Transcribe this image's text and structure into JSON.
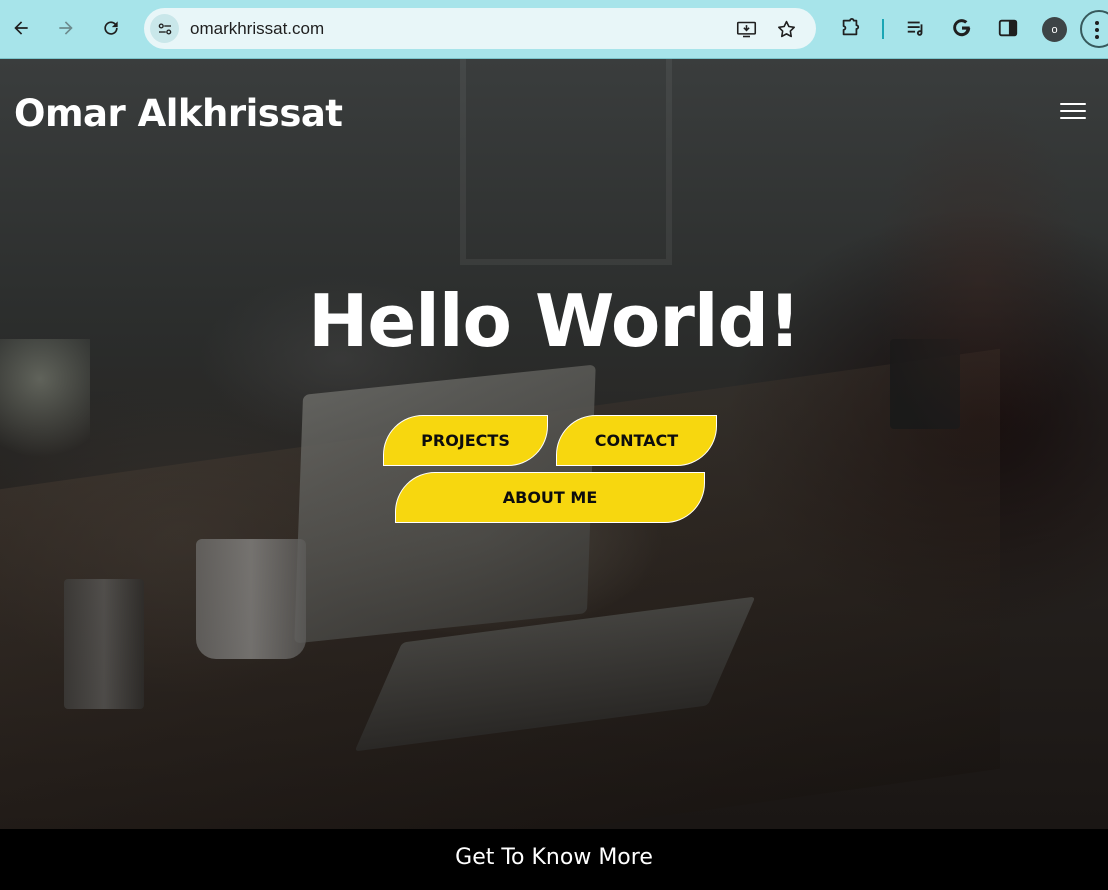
{
  "browser": {
    "url": "omarkhrissat.com",
    "profile_initial": "o",
    "icons": {
      "back": "back-arrow-icon",
      "forward": "forward-arrow-icon",
      "reload": "reload-icon",
      "site_info": "site-info-icon",
      "install": "install-app-icon",
      "bookmark": "star-icon",
      "extensions": "puzzle-icon",
      "media": "media-queue-icon",
      "google": "google-icon",
      "side_panel": "side-panel-icon",
      "menu": "kebab-menu-icon"
    },
    "colors": {
      "toolbar": "#a7e4ea",
      "omnibox": "#e8f6f8"
    }
  },
  "site": {
    "brand": "Omar Alkhrissat",
    "nav_icon": "hamburger-menu-icon",
    "headline": "Hello World!",
    "buttons": {
      "projects": "PROJECTS",
      "contact": "CONTACT",
      "about": "ABOUT ME"
    },
    "footer_link": "Get To Know More",
    "colors": {
      "accent": "#f7d70f",
      "text": "#ffffff",
      "background": "#000000"
    }
  }
}
